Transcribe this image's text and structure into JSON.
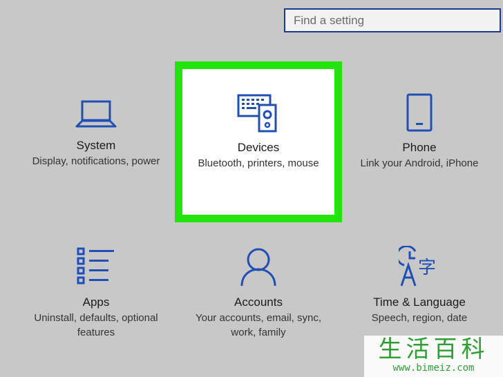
{
  "search": {
    "placeholder": "Find a setting"
  },
  "tiles": [
    {
      "title": "System",
      "desc": "Display, notifications, power",
      "icon": "laptop-icon"
    },
    {
      "title": "Devices",
      "desc": "Bluetooth, printers, mouse",
      "icon": "keyboard-speaker-icon"
    },
    {
      "title": "Phone",
      "desc": "Link your Android, iPhone",
      "icon": "phone-icon"
    },
    {
      "title": "Apps",
      "desc": "Uninstall, defaults, optional features",
      "icon": "apps-list-icon"
    },
    {
      "title": "Accounts",
      "desc": "Your accounts, email, sync, work, family",
      "icon": "person-icon"
    },
    {
      "title": "Time & Language",
      "desc": "Speech, region, date",
      "icon": "clock-language-icon"
    }
  ],
  "watermark": {
    "chars": "生活百科",
    "url": "www.bimeiz.com"
  },
  "colors": {
    "accent": "#1a3a8c",
    "icon": "#1f4fb4",
    "highlight": "#22e50e",
    "background": "#c8c8c8"
  }
}
